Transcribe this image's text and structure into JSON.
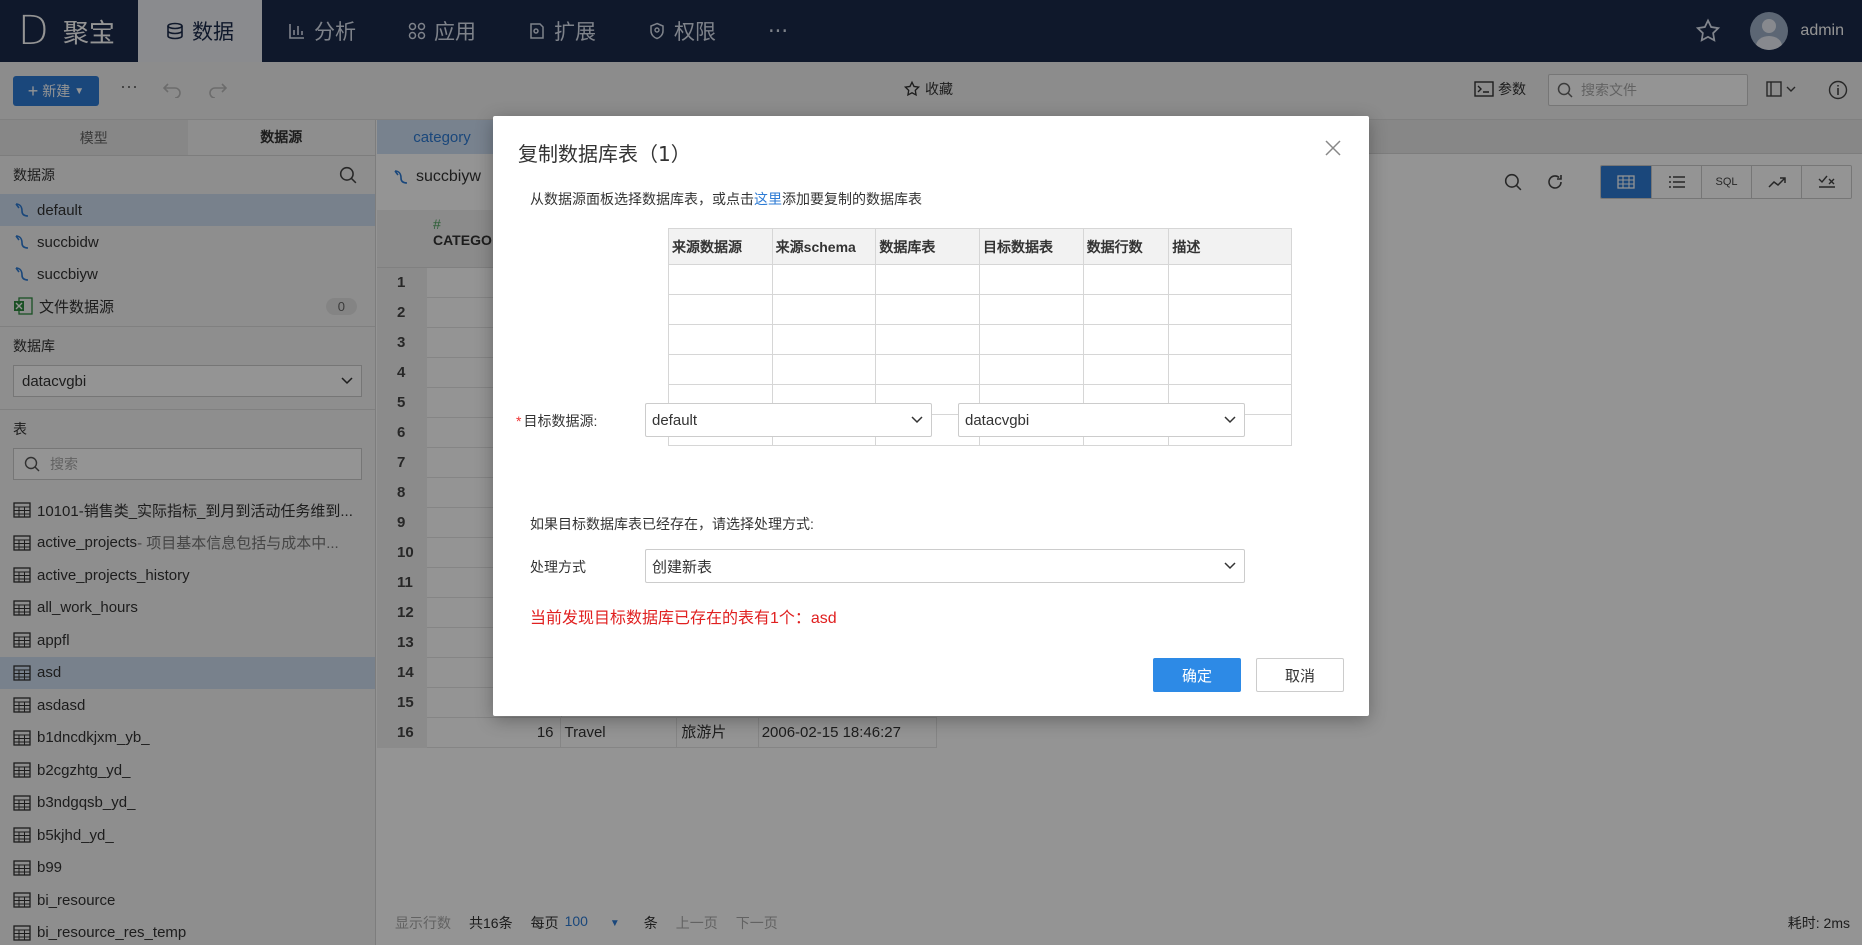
{
  "app": {
    "logo": "D",
    "name": "聚宝",
    "user": "admin"
  },
  "nav": {
    "items": [
      {
        "label": "数据",
        "icon": "database-icon",
        "active": true
      },
      {
        "label": "分析",
        "icon": "bar-chart-icon",
        "active": false
      },
      {
        "label": "应用",
        "icon": "apps-icon",
        "active": false
      },
      {
        "label": "扩展",
        "icon": "extension-icon",
        "active": false
      },
      {
        "label": "权限",
        "icon": "shield-icon",
        "active": false
      }
    ],
    "more": "···"
  },
  "toolbar": {
    "new_label": "新建",
    "favorite_label": "收藏",
    "params_label": "参数",
    "search_placeholder": "搜索文件"
  },
  "left": {
    "tabs": [
      "模型",
      "数据源"
    ],
    "datasource_title": "数据源",
    "datasources": [
      {
        "name": "default",
        "selected": true
      },
      {
        "name": "succbidw",
        "selected": false
      },
      {
        "name": "succbiyw",
        "selected": false
      }
    ],
    "file_datasource": {
      "name": "文件数据源",
      "count": "0"
    },
    "database_title": "数据库",
    "database_value": "datacvgbi",
    "table_title": "表",
    "table_search_placeholder": "搜索",
    "tables": [
      {
        "name": "10101-销售类_实际指标_到月到活动任务维到...",
        "desc": ""
      },
      {
        "name": "active_projects",
        "desc": " - 项目基本信息包括与成本中..."
      },
      {
        "name": "active_projects_history",
        "desc": ""
      },
      {
        "name": "all_work_hours",
        "desc": ""
      },
      {
        "name": "appfl",
        "desc": ""
      },
      {
        "name": "asd",
        "desc": ""
      },
      {
        "name": "asdasd",
        "desc": ""
      },
      {
        "name": "b1dncdkjxm_yb_",
        "desc": ""
      },
      {
        "name": "b2cgzhtg_yd_",
        "desc": ""
      },
      {
        "name": "b3ndgqsb_yd_",
        "desc": ""
      },
      {
        "name": "b5kjhd_yd_",
        "desc": ""
      },
      {
        "name": "b99",
        "desc": ""
      },
      {
        "name": "bi_resource",
        "desc": ""
      },
      {
        "name": "bi_resource_res_temp",
        "desc": ""
      }
    ]
  },
  "content": {
    "tab_label": "category",
    "title": "succbiyw",
    "column_header": "CATEGO",
    "view_sql_label": "SQL",
    "row_numbers": [
      "1",
      "2",
      "3",
      "4",
      "5",
      "6",
      "7",
      "8",
      "9",
      "10",
      "11",
      "12",
      "13",
      "14",
      "15",
      "16"
    ],
    "last_row": {
      "id": "16",
      "name": "Travel",
      "cn": "旅游片",
      "time": "2006-02-15 18:46:27"
    },
    "pager": {
      "show_rows": "显示行数",
      "total": "共16条",
      "per_page": "每页",
      "page_size": "100",
      "unit": "条",
      "prev": "上一页",
      "next": "下一页"
    },
    "elapsed": "耗时: 2ms"
  },
  "dialog": {
    "title": "复制数据库表（1）",
    "hint_before": "从数据源面板选择数据库表，或点击",
    "hint_link": "这里",
    "hint_after": "添加要复制的数据库表",
    "columns": [
      "来源数据源",
      "来源schema",
      "数据库表",
      "目标数据表",
      "数据行数",
      "描述"
    ],
    "target_label": "目标数据源:",
    "target_ds": "default",
    "target_db": "datacvgbi",
    "exists_prompt": "如果目标数据库表已经存在，请选择处理方式:",
    "mode_label": "处理方式",
    "mode_value": "创建新表",
    "warning": "当前发现目标数据库已存在的表有1个：asd",
    "ok": "确定",
    "cancel": "取消"
  }
}
